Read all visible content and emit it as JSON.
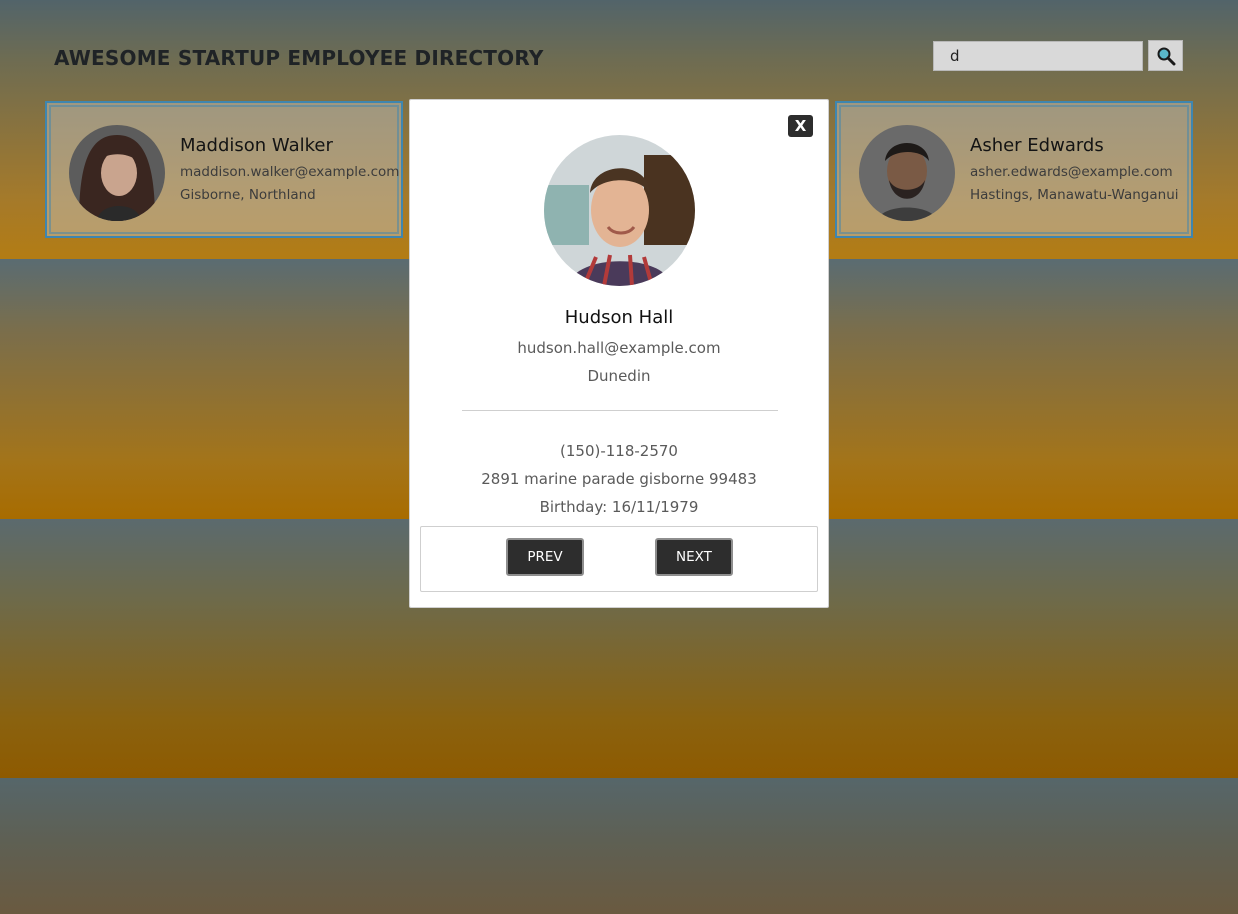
{
  "header": {
    "title": "AWESOME STARTUP EMPLOYEE DIRECTORY"
  },
  "search": {
    "value": "d",
    "button_icon": "magnifier-icon"
  },
  "cards": [
    {
      "name": "Maddison Walker",
      "email": "maddison.walker@example.com",
      "city": "Gisborne, Northland"
    },
    {
      "name": "Asher Edwards",
      "email": "asher.edwards@example.com",
      "city": "Hastings, Manawatu-Wanganui"
    }
  ],
  "modal": {
    "close_label": "X",
    "name": "Hudson Hall",
    "email": "hudson.hall@example.com",
    "city": "Dunedin",
    "phone": "(150)-118-2570",
    "address": "2891 marine parade gisborne 99483",
    "birthday": "Birthday: 16/11/1979",
    "prev_label": "PREV",
    "next_label": "NEXT"
  },
  "colors": {
    "card_border": "#3e86b0",
    "button_bg": "#2d2d2d",
    "stripe_gold": "#b37c14"
  }
}
